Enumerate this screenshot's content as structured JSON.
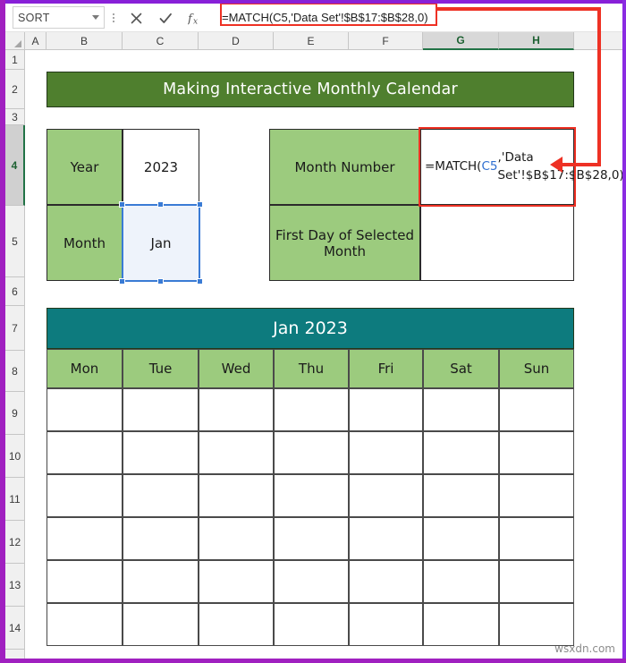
{
  "formula_bar": {
    "name_box_value": "SORT",
    "cancel_icon": "close-icon",
    "enter_icon": "check-icon",
    "function_icon": "fx-icon",
    "formula_text": "=MATCH(C5,'Data Set'!$B$17:$B$28,0)"
  },
  "grid": {
    "columns": [
      "A",
      "B",
      "C",
      "D",
      "E",
      "F",
      "G",
      "H"
    ],
    "selected_columns": [
      "G",
      "H"
    ],
    "rows": [
      "1",
      "2",
      "3",
      "4",
      "5",
      "6",
      "7",
      "8",
      "9",
      "10",
      "11",
      "12",
      "13",
      "14"
    ],
    "selected_rows": [
      "4"
    ]
  },
  "sheet": {
    "title_banner": "Making Interactive Monthly Calendar",
    "year_label": "Year",
    "year_value": "2023",
    "month_label": "Month",
    "month_value": "Jan",
    "month_number_label": "Month Number",
    "month_number_formula_part1": "=MATCH(",
    "month_number_formula_ref": "C5",
    "month_number_formula_part2": ",'Data Set'!$B$17:$B$28,0)",
    "first_day_label": "First Day of Selected Month",
    "first_day_value": "",
    "calendar_title": "Jan 2023",
    "weekdays": [
      "Mon",
      "Tue",
      "Wed",
      "Thu",
      "Fri",
      "Sat",
      "Sun"
    ],
    "calendar_rows": 6
  },
  "colors": {
    "banner_green": "#4f7f2e",
    "label_green": "#9ccb7e",
    "calendar_teal": "#0d7b7e",
    "highlight_red": "#ee3124",
    "selection_blue": "#3a7bd5",
    "frame_purple": "#a020c0"
  },
  "watermark": "wsxdn.com"
}
